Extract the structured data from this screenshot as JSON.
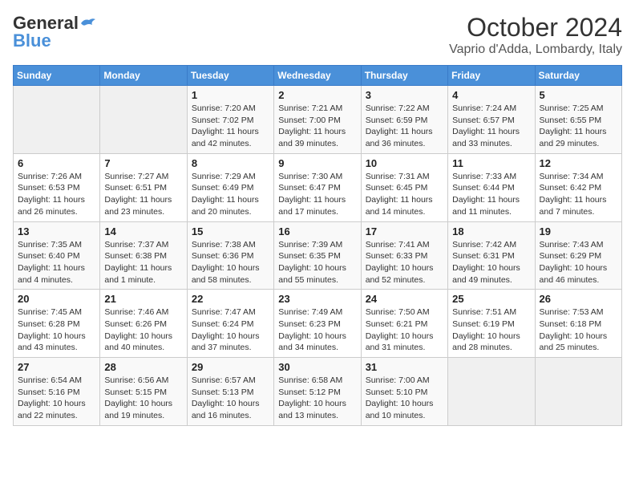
{
  "logo": {
    "general": "General",
    "blue": "Blue"
  },
  "title": "October 2024",
  "subtitle": "Vaprio d'Adda, Lombardy, Italy",
  "days_of_week": [
    "Sunday",
    "Monday",
    "Tuesday",
    "Wednesday",
    "Thursday",
    "Friday",
    "Saturday"
  ],
  "weeks": [
    [
      {
        "day": "",
        "info": ""
      },
      {
        "day": "",
        "info": ""
      },
      {
        "day": "1",
        "info": "Sunrise: 7:20 AM\nSunset: 7:02 PM\nDaylight: 11 hours and 42 minutes."
      },
      {
        "day": "2",
        "info": "Sunrise: 7:21 AM\nSunset: 7:00 PM\nDaylight: 11 hours and 39 minutes."
      },
      {
        "day": "3",
        "info": "Sunrise: 7:22 AM\nSunset: 6:59 PM\nDaylight: 11 hours and 36 minutes."
      },
      {
        "day": "4",
        "info": "Sunrise: 7:24 AM\nSunset: 6:57 PM\nDaylight: 11 hours and 33 minutes."
      },
      {
        "day": "5",
        "info": "Sunrise: 7:25 AM\nSunset: 6:55 PM\nDaylight: 11 hours and 29 minutes."
      }
    ],
    [
      {
        "day": "6",
        "info": "Sunrise: 7:26 AM\nSunset: 6:53 PM\nDaylight: 11 hours and 26 minutes."
      },
      {
        "day": "7",
        "info": "Sunrise: 7:27 AM\nSunset: 6:51 PM\nDaylight: 11 hours and 23 minutes."
      },
      {
        "day": "8",
        "info": "Sunrise: 7:29 AM\nSunset: 6:49 PM\nDaylight: 11 hours and 20 minutes."
      },
      {
        "day": "9",
        "info": "Sunrise: 7:30 AM\nSunset: 6:47 PM\nDaylight: 11 hours and 17 minutes."
      },
      {
        "day": "10",
        "info": "Sunrise: 7:31 AM\nSunset: 6:45 PM\nDaylight: 11 hours and 14 minutes."
      },
      {
        "day": "11",
        "info": "Sunrise: 7:33 AM\nSunset: 6:44 PM\nDaylight: 11 hours and 11 minutes."
      },
      {
        "day": "12",
        "info": "Sunrise: 7:34 AM\nSunset: 6:42 PM\nDaylight: 11 hours and 7 minutes."
      }
    ],
    [
      {
        "day": "13",
        "info": "Sunrise: 7:35 AM\nSunset: 6:40 PM\nDaylight: 11 hours and 4 minutes."
      },
      {
        "day": "14",
        "info": "Sunrise: 7:37 AM\nSunset: 6:38 PM\nDaylight: 11 hours and 1 minute."
      },
      {
        "day": "15",
        "info": "Sunrise: 7:38 AM\nSunset: 6:36 PM\nDaylight: 10 hours and 58 minutes."
      },
      {
        "day": "16",
        "info": "Sunrise: 7:39 AM\nSunset: 6:35 PM\nDaylight: 10 hours and 55 minutes."
      },
      {
        "day": "17",
        "info": "Sunrise: 7:41 AM\nSunset: 6:33 PM\nDaylight: 10 hours and 52 minutes."
      },
      {
        "day": "18",
        "info": "Sunrise: 7:42 AM\nSunset: 6:31 PM\nDaylight: 10 hours and 49 minutes."
      },
      {
        "day": "19",
        "info": "Sunrise: 7:43 AM\nSunset: 6:29 PM\nDaylight: 10 hours and 46 minutes."
      }
    ],
    [
      {
        "day": "20",
        "info": "Sunrise: 7:45 AM\nSunset: 6:28 PM\nDaylight: 10 hours and 43 minutes."
      },
      {
        "day": "21",
        "info": "Sunrise: 7:46 AM\nSunset: 6:26 PM\nDaylight: 10 hours and 40 minutes."
      },
      {
        "day": "22",
        "info": "Sunrise: 7:47 AM\nSunset: 6:24 PM\nDaylight: 10 hours and 37 minutes."
      },
      {
        "day": "23",
        "info": "Sunrise: 7:49 AM\nSunset: 6:23 PM\nDaylight: 10 hours and 34 minutes."
      },
      {
        "day": "24",
        "info": "Sunrise: 7:50 AM\nSunset: 6:21 PM\nDaylight: 10 hours and 31 minutes."
      },
      {
        "day": "25",
        "info": "Sunrise: 7:51 AM\nSunset: 6:19 PM\nDaylight: 10 hours and 28 minutes."
      },
      {
        "day": "26",
        "info": "Sunrise: 7:53 AM\nSunset: 6:18 PM\nDaylight: 10 hours and 25 minutes."
      }
    ],
    [
      {
        "day": "27",
        "info": "Sunrise: 6:54 AM\nSunset: 5:16 PM\nDaylight: 10 hours and 22 minutes."
      },
      {
        "day": "28",
        "info": "Sunrise: 6:56 AM\nSunset: 5:15 PM\nDaylight: 10 hours and 19 minutes."
      },
      {
        "day": "29",
        "info": "Sunrise: 6:57 AM\nSunset: 5:13 PM\nDaylight: 10 hours and 16 minutes."
      },
      {
        "day": "30",
        "info": "Sunrise: 6:58 AM\nSunset: 5:12 PM\nDaylight: 10 hours and 13 minutes."
      },
      {
        "day": "31",
        "info": "Sunrise: 7:00 AM\nSunset: 5:10 PM\nDaylight: 10 hours and 10 minutes."
      },
      {
        "day": "",
        "info": ""
      },
      {
        "day": "",
        "info": ""
      }
    ]
  ]
}
